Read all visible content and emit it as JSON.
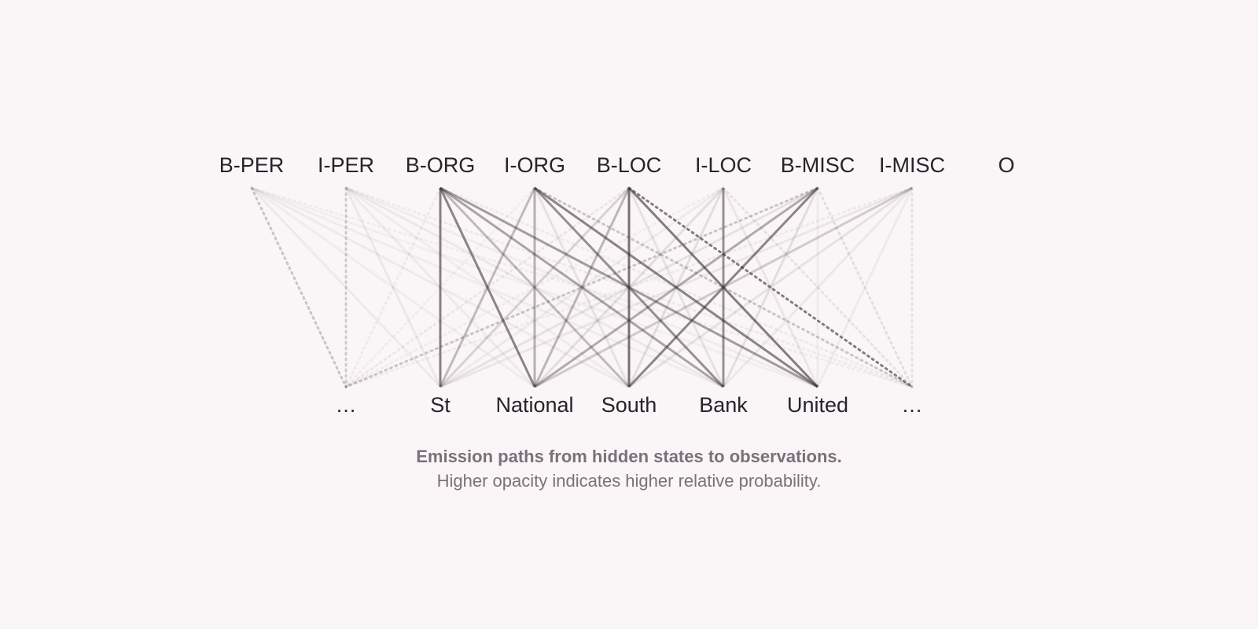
{
  "diagram": {
    "type": "bipartite-emission-graph",
    "edge_color": "#3a3237",
    "states": [
      "B-PER",
      "I-PER",
      "B-ORG",
      "I-ORG",
      "B-LOC",
      "I-LOC",
      "B-MISC",
      "I-MISC",
      "O"
    ],
    "observations": [
      "...",
      "St",
      "National",
      "South",
      "Bank",
      "United",
      "..."
    ],
    "dotted_observations": [
      0,
      6
    ],
    "emission_opacity": [
      [
        0.25,
        0.06,
        0.05,
        0.06,
        0.05,
        0.04,
        0.05
      ],
      [
        0.22,
        0.07,
        0.06,
        0.05,
        0.07,
        0.05,
        0.06
      ],
      [
        0.06,
        0.6,
        0.58,
        0.3,
        0.42,
        0.45,
        0.06
      ],
      [
        0.05,
        0.3,
        0.35,
        0.1,
        0.52,
        0.58,
        0.25
      ],
      [
        0.08,
        0.18,
        0.32,
        0.68,
        0.1,
        0.62,
        0.62
      ],
      [
        0.05,
        0.06,
        0.12,
        0.12,
        0.52,
        0.08,
        0.1
      ],
      [
        0.25,
        0.1,
        0.38,
        0.58,
        0.12,
        0.05,
        0.12
      ],
      [
        0.06,
        0.08,
        0.22,
        0.1,
        0.07,
        0.06,
        0.1
      ],
      [
        0.0,
        0.0,
        0.0,
        0.0,
        0.0,
        0.0,
        0.0
      ]
    ]
  },
  "caption": {
    "title": "Emission paths from hidden states to observations.",
    "subtitle": "Higher opacity indicates higher relative probability."
  }
}
